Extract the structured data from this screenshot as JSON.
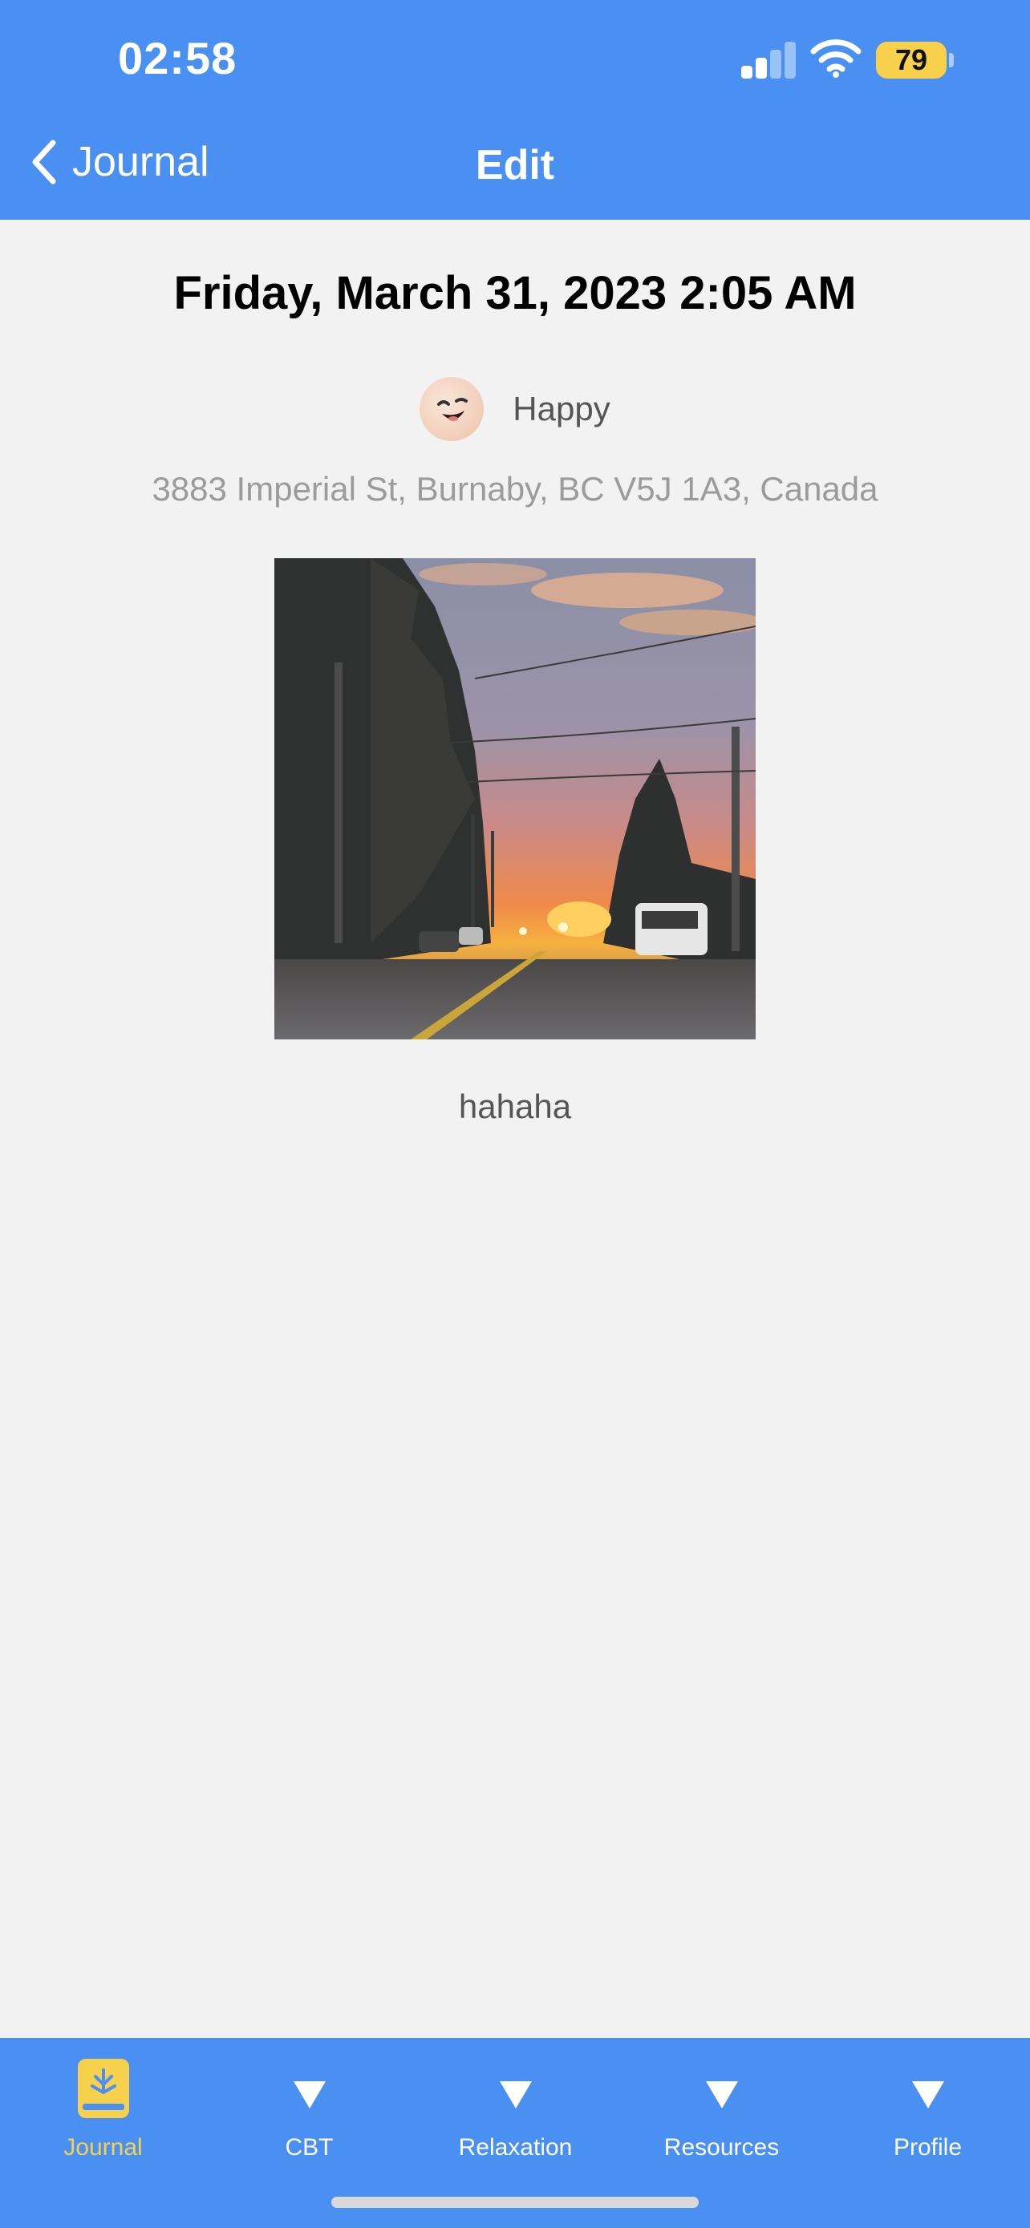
{
  "status_bar": {
    "time": "02:58",
    "battery": "79"
  },
  "nav": {
    "back_label": "Journal",
    "title": "Edit"
  },
  "entry": {
    "date": "Friday, March 31, 2023 2:05 AM",
    "mood": "Happy",
    "location": "3883 Imperial St, Burnaby, BC V5J 1A3, Canada",
    "text": "hahaha"
  },
  "tabs": [
    {
      "label": "Journal",
      "icon": "journal-book-icon",
      "active": true
    },
    {
      "label": "CBT",
      "icon": "triangle-down-icon",
      "active": false
    },
    {
      "label": "Relaxation",
      "icon": "triangle-down-icon",
      "active": false
    },
    {
      "label": "Resources",
      "icon": "triangle-down-icon",
      "active": false
    },
    {
      "label": "Profile",
      "icon": "triangle-down-icon",
      "active": false
    }
  ],
  "colors": {
    "primary": "#4a90f2",
    "accent": "#f7d14c",
    "background": "#f2f2f2"
  }
}
